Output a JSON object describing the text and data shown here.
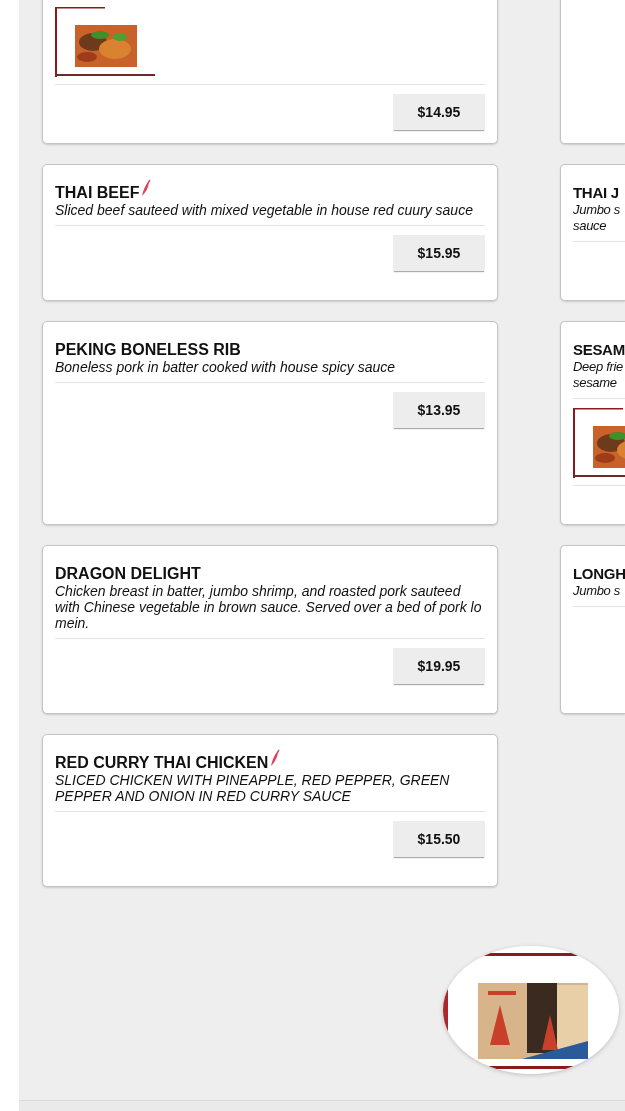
{
  "rows": [
    {
      "left": {
        "price": "$14.95"
      },
      "right": {}
    },
    {
      "left": {
        "name": "THAI BEEF",
        "spicy": true,
        "description": "Sliced beef sauteed with mixed vegetable in house red cuury sauce",
        "price": "$15.95"
      },
      "right": {
        "name": "THAI J",
        "spicy": false,
        "description_lines": [
          "Jumbo s",
          "sauce"
        ]
      }
    },
    {
      "left": {
        "name": "PEKING BONELESS RIB",
        "spicy": false,
        "description": "Boneless pork in batter cooked with house spicy sauce",
        "price": "$13.95"
      },
      "right": {
        "name": "SESAM",
        "spicy": false,
        "description_lines": [
          "Deep frie",
          "sesame"
        ]
      }
    },
    {
      "left": {
        "name": "DRAGON DELIGHT",
        "spicy": false,
        "description": "Chicken breast in batter, jumbo shrimp, and roasted pork sauteed with Chinese vegetable in brown sauce. Served over a bed of pork lo mein.",
        "price": "$19.95"
      },
      "right": {
        "name": "LONGH",
        "spicy": false,
        "description_lines": [
          "Jumbo s"
        ]
      }
    },
    {
      "left": {
        "name": "RED CURRY THAI CHICKEN",
        "spicy": true,
        "description": "SLICED CHICKEN WITH PINEAPPLE, RED PEPPER, GREEN PEPPER AND ONION IN RED CURRY SAUCE",
        "price": "$15.50"
      }
    }
  ]
}
